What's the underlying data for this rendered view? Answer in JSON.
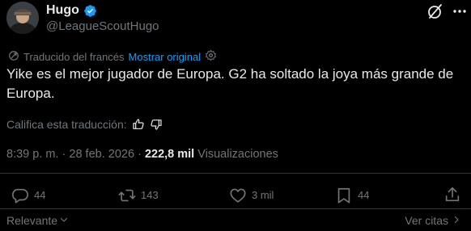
{
  "author": {
    "display_name": "Hugo",
    "handle": "@LeagueScoutHugo",
    "verified": true
  },
  "translation": {
    "label": "Traducido del francés",
    "show_original": "Mostrar original"
  },
  "tweet": {
    "text": "Yike es el mejor jugador de Europa. G2 ha soltado la joya más grande de Europa."
  },
  "rating": {
    "label": "Califica esta traducción:"
  },
  "meta": {
    "time": "8:39 p. m.",
    "separator": "·",
    "date": "28 feb. 2026",
    "views_count": "222,8 mil",
    "views_label": "Visualizaciones"
  },
  "actions": {
    "replies": "44",
    "reposts": "143",
    "likes": "3 mil",
    "bookmarks": "44"
  },
  "footer": {
    "sort_label": "Relevante",
    "quotes_label": "Ver citas"
  },
  "colors": {
    "background": "#000000",
    "text": "#e7e9ea",
    "secondary": "#71767b",
    "accent": "#1d9bf0",
    "divider": "#2f3336"
  },
  "icons": {
    "verified": "verified-badge-icon",
    "grok": "grok-icon",
    "more": "more-icon",
    "translate": "translate-icon",
    "settings": "gear-icon",
    "thumbs_up": "thumbs-up-icon",
    "thumbs_down": "thumbs-down-icon",
    "reply": "reply-icon",
    "repost": "repost-icon",
    "like": "heart-icon",
    "bookmark": "bookmark-icon",
    "share": "share-icon",
    "chevron_down": "chevron-down-icon",
    "chevron_right": "chevron-right-icon"
  }
}
